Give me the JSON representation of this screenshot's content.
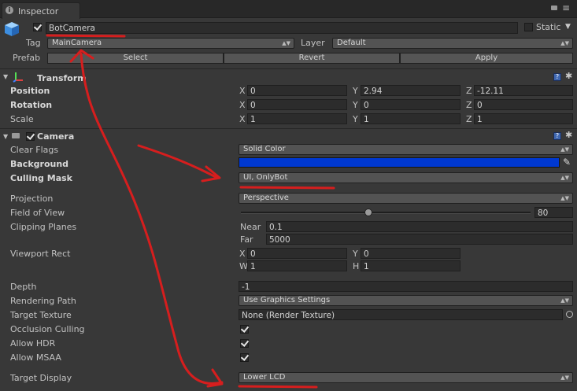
{
  "tab": {
    "label": "Inspector"
  },
  "colors": {
    "accent_red": "#d61e1e",
    "background_swatch": "#0038d0"
  },
  "object": {
    "name": "BotCamera",
    "active": true,
    "static_label": "Static",
    "static_checked": false,
    "tag_label": "Tag",
    "tag_value": "MainCamera",
    "layer_label": "Layer",
    "layer_value": "Default",
    "prefab_label": "Prefab",
    "prefab_buttons": [
      "Select",
      "Revert",
      "Apply"
    ]
  },
  "transform": {
    "title": "Transform",
    "rows": [
      {
        "label": "Position",
        "bold": true,
        "x": "0",
        "y": "2.94",
        "z": "-12.11"
      },
      {
        "label": "Rotation",
        "bold": true,
        "x": "0",
        "y": "0",
        "z": "0"
      },
      {
        "label": "Scale",
        "bold": false,
        "x": "1",
        "y": "1",
        "z": "1"
      }
    ],
    "axes": [
      "X",
      "Y",
      "Z"
    ]
  },
  "camera": {
    "title": "Camera",
    "enabled": true,
    "clear_flags_label": "Clear Flags",
    "clear_flags_value": "Solid Color",
    "background_label": "Background",
    "culling_mask_label": "Culling Mask",
    "culling_mask_value": "UI, OnlyBot",
    "projection_label": "Projection",
    "projection_value": "Perspective",
    "fov_label": "Field of View",
    "fov_value": "80",
    "fov_fraction": 0.44,
    "clipping_label": "Clipping Planes",
    "near_label": "Near",
    "near_value": "0.1",
    "far_label": "Far",
    "far_value": "5000",
    "viewport_label": "Viewport Rect",
    "viewport": {
      "x_label": "X",
      "x": "0",
      "y_label": "Y",
      "y": "0",
      "w_label": "W",
      "w": "1",
      "h_label": "H",
      "h": "1"
    },
    "depth_label": "Depth",
    "depth_value": "-1",
    "rendering_path_label": "Rendering Path",
    "rendering_path_value": "Use Graphics Settings",
    "target_texture_label": "Target Texture",
    "target_texture_value": "None (Render Texture)",
    "occlusion_label": "Occlusion Culling",
    "occlusion_checked": true,
    "hdr_label": "Allow HDR",
    "hdr_checked": true,
    "msaa_label": "Allow MSAA",
    "msaa_checked": true,
    "target_display_label": "Target Display",
    "target_display_value": "Lower LCD"
  }
}
